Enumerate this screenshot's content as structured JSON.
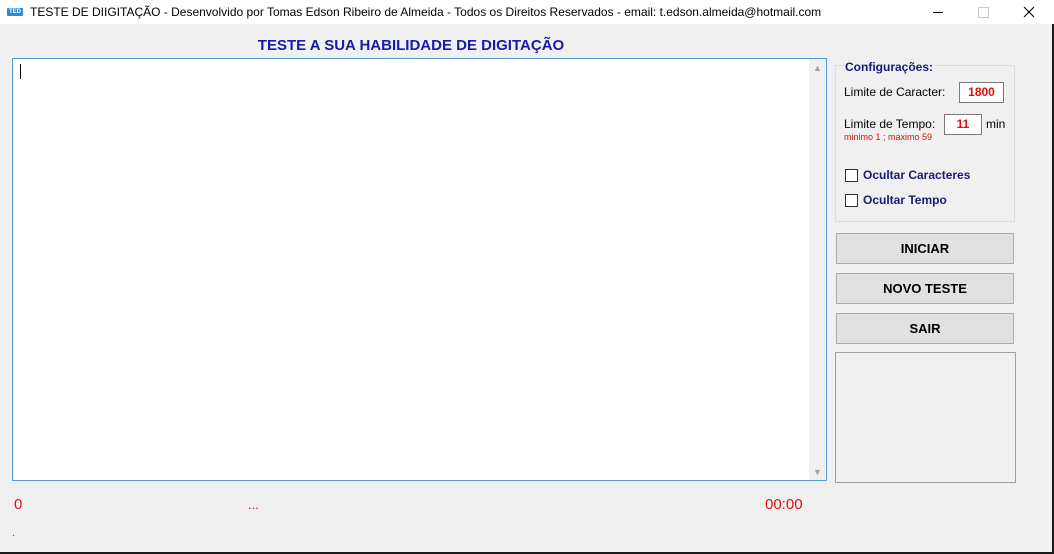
{
  "window": {
    "title": "TESTE DE DIIGITAÇÃO - Desenvolvido por Tomas Edson Ribeiro de Almeida - Todos os Direitos Reservados - email: t.edson.almeida@hotmail.com",
    "icon_text": "TED"
  },
  "main": {
    "headline": "TESTE A SUA HABILIDADE DE DIGITAÇÃO",
    "typing_text": ""
  },
  "config": {
    "title": "Configurações:",
    "char_limit_label": "Limite de Caracter:",
    "char_limit_value": "1800",
    "time_limit_label": "Limite de Tempo:",
    "time_limit_value": "11",
    "time_unit": "min",
    "time_hint": "minimo 1 ; maximo 59",
    "hide_chars_label": "Ocultar Caracteres",
    "hide_chars_checked": false,
    "hide_time_label": "Ocultar Tempo",
    "hide_time_checked": false
  },
  "buttons": {
    "start": "INICIAR",
    "new_test": "NOVO TESTE",
    "exit": "SAIR"
  },
  "status": {
    "char_count": "0",
    "progress": "...",
    "timer": "00:00",
    "footer_mark": "."
  },
  "colors": {
    "accent_blue": "#1a1aa8",
    "value_red": "#e01010"
  }
}
